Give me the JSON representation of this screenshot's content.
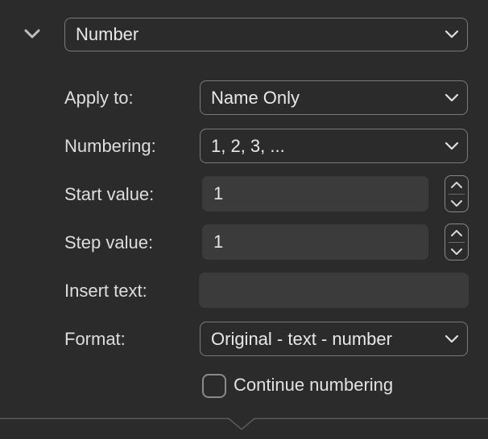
{
  "collapse_icon": "chevron-down-icon",
  "type_popup": {
    "value": "Number"
  },
  "apply_to": {
    "label": "Apply to:",
    "value": "Name Only"
  },
  "numbering": {
    "label": "Numbering:",
    "value": "1, 2, 3, ..."
  },
  "start_value": {
    "label": "Start value:",
    "value": "1"
  },
  "step_value": {
    "label": "Step value:",
    "value": "1"
  },
  "insert_text": {
    "label": "Insert text:",
    "value": ""
  },
  "format": {
    "label": "Format:",
    "value": "Original - text - number"
  },
  "continue_numbering": {
    "label": "Continue numbering",
    "checked": false
  }
}
